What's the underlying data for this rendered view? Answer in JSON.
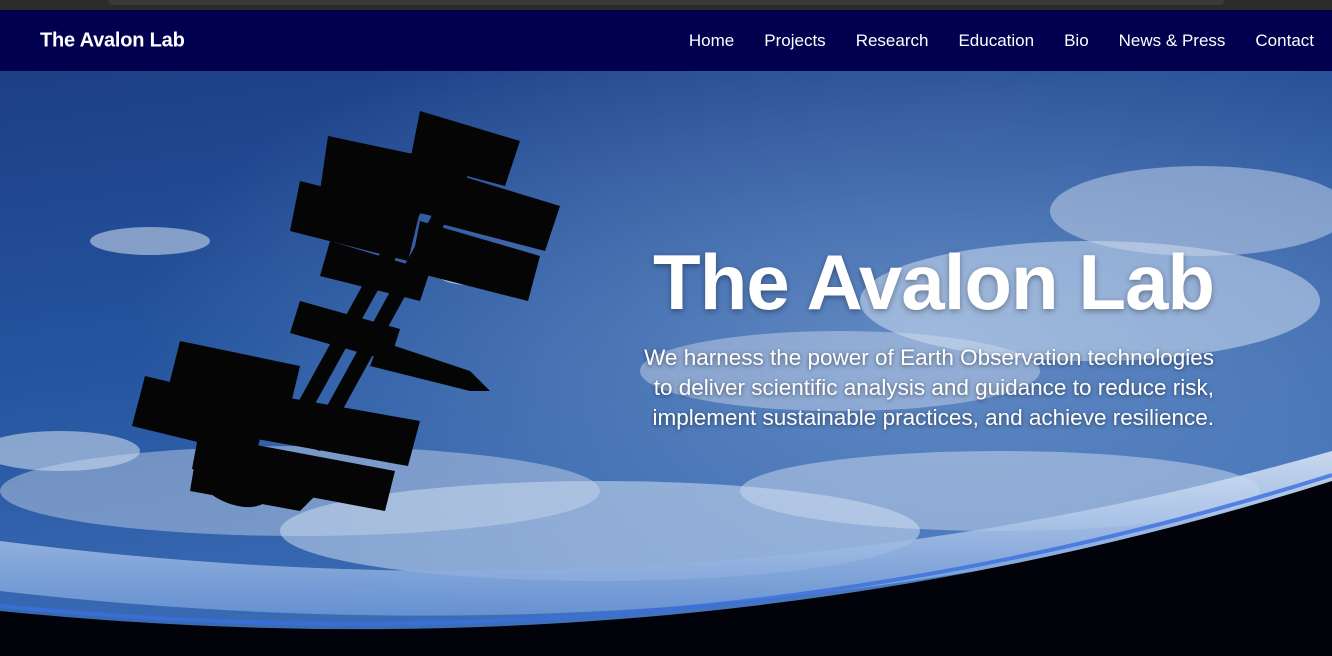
{
  "nav": {
    "brand": "The Avalon Lab",
    "links": [
      "Home",
      "Projects",
      "Research",
      "Education",
      "Bio",
      "News & Press",
      "Contact"
    ]
  },
  "hero": {
    "title": "The Avalon Lab",
    "tagline_lines": [
      "We harness the power of Earth Observation technologies",
      "to deliver scientific analysis and guidance to reduce risk,",
      "implement sustainable practices, and achieve resilience."
    ],
    "background_icon": "earth-satellite-photo"
  },
  "colors": {
    "nav_bg": "#00004f",
    "text": "#ffffff"
  }
}
